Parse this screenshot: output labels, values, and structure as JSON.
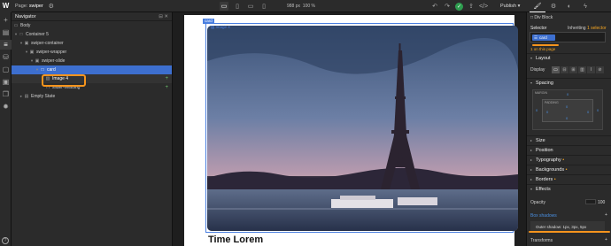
{
  "topbar": {
    "logo": "W",
    "page_label": "Page:",
    "page_name": "swiper",
    "width": "988",
    "unit": "px",
    "zoom": "100",
    "zoom_unit": "%",
    "publish_label": "Publish"
  },
  "navigator": {
    "title": "Navigator",
    "items": [
      {
        "label": "Body"
      },
      {
        "label": "Container 5"
      },
      {
        "label": "swiper-container"
      },
      {
        "label": "swiper-wrapper"
      },
      {
        "label": "swiper-slide"
      },
      {
        "label": "card"
      },
      {
        "label": "Image 4"
      },
      {
        "label": "slider-heading"
      },
      {
        "label": "Empty State"
      }
    ]
  },
  "canvas": {
    "card_tag": "card",
    "image_tag": "Image 4",
    "heading": "Time Lorem"
  },
  "panel": {
    "element_type": "Div Block",
    "selector_label": "Selector",
    "inheriting_label": "Inheriting",
    "inheriting_count": "1 selector",
    "selector_chip": "card",
    "on_this_page": "1 on this page",
    "layout_label": "Layout",
    "display_label": "Display",
    "spacing_label": "Spacing",
    "margin_label": "MARGIN",
    "padding_label": "PADDING",
    "zero": "0",
    "size_label": "Size",
    "position_label": "Position",
    "typography_label": "Typography",
    "backgrounds_label": "Backgrounds",
    "borders_label": "Borders",
    "effects_label": "Effects",
    "opacity_label": "Opacity",
    "opacity_value": "100",
    "box_shadows_label": "Box shadows",
    "shadow_value": "Outer shadow: 1px, 3px, 5px",
    "transforms_label": "Transforms"
  },
  "colors": {
    "accent": "#3d6fcf",
    "highlight": "#f5941d",
    "success": "#2e9d4f"
  }
}
